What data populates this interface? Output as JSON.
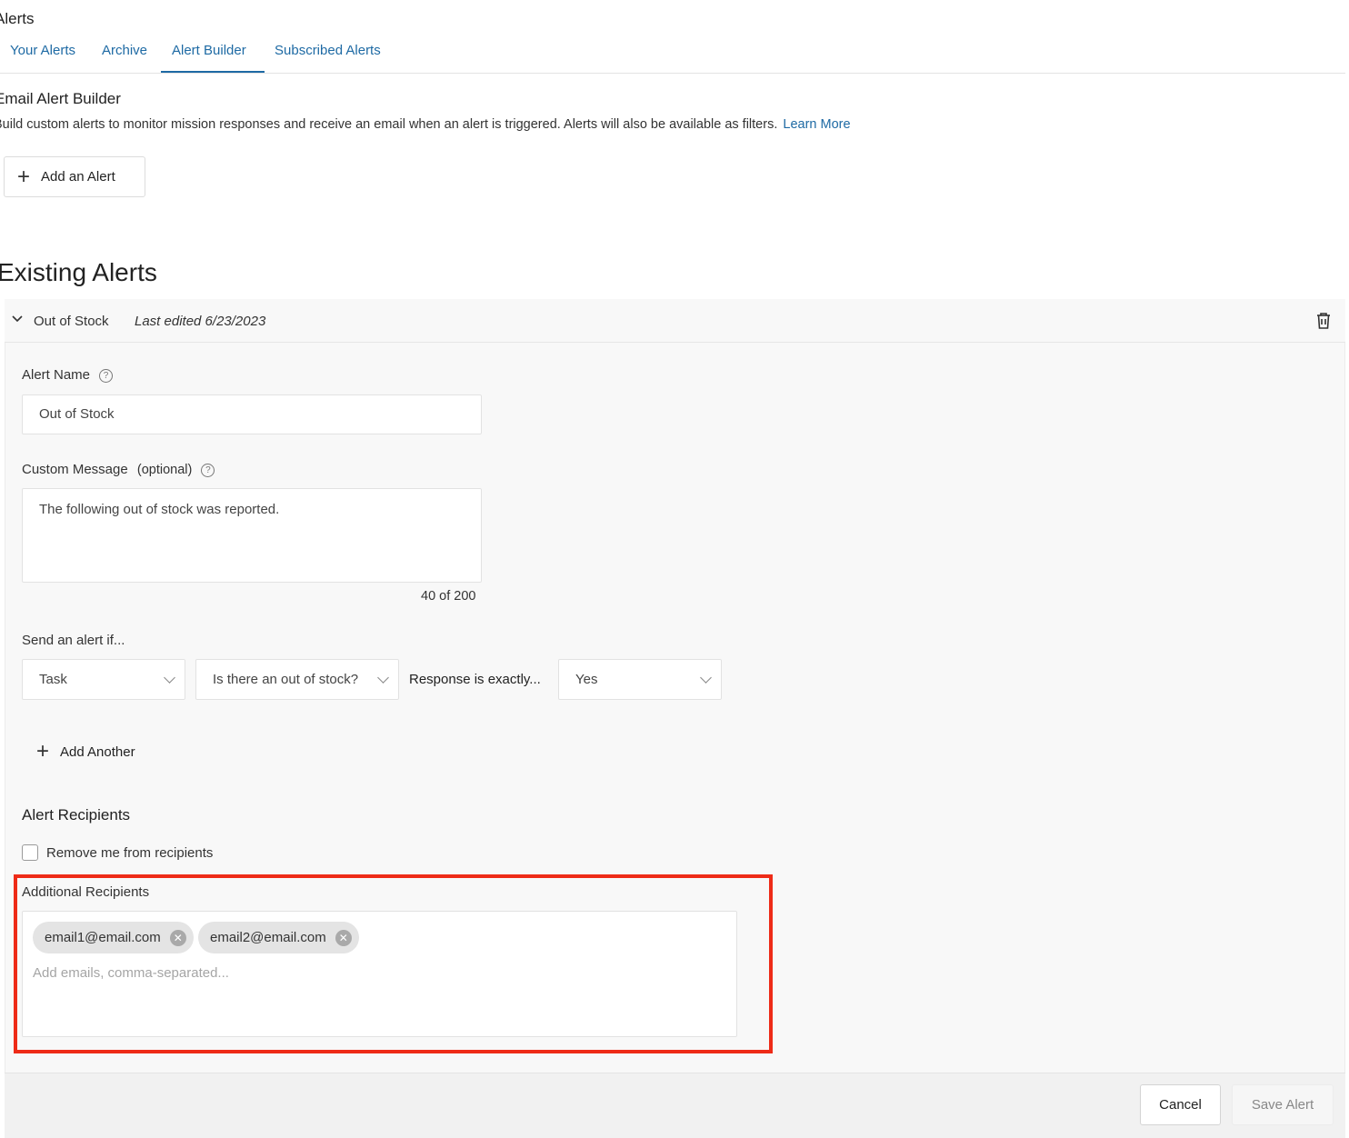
{
  "page": {
    "heading": "Alerts"
  },
  "tabs": [
    {
      "label": "Your Alerts"
    },
    {
      "label": "Archive"
    },
    {
      "label": "Alert Builder"
    },
    {
      "label": "Subscribed Alerts"
    }
  ],
  "builder": {
    "title": "Email Alert Builder",
    "description": "Build custom alerts to monitor mission responses and receive an email when an alert is triggered. Alerts will also be available as filters.",
    "learn_more": "Learn More",
    "add_alert_label": "Add an Alert"
  },
  "existing": {
    "title": "Existing Alerts",
    "alert": {
      "name": "Out of Stock",
      "last_edited": "Last edited 6/23/2023"
    }
  },
  "form": {
    "alert_name_label": "Alert Name",
    "alert_name_value": "Out of Stock",
    "custom_message_label": "Custom Message",
    "custom_message_optional": "(optional)",
    "custom_message_value": "The following out of stock was reported.",
    "char_count": "40 of 200",
    "condition_label": "Send an alert if...",
    "condition": {
      "type_select": "Task",
      "question_select": "Is there an out of stock?",
      "operator_text": "Response is exactly...",
      "value_select": "Yes"
    },
    "add_another_label": "Add Another",
    "recipients_heading": "Alert Recipients",
    "remove_me_label": "Remove me from recipients",
    "remove_me_checked": false,
    "additional_label": "Additional Recipients",
    "recipients": [
      "email1@email.com",
      "email2@email.com"
    ],
    "recipients_placeholder": "Add emails, comma-separated..."
  },
  "footer": {
    "cancel_label": "Cancel",
    "save_label": "Save Alert"
  },
  "colors": {
    "link": "#1e6aa4",
    "highlight": "#ee2b17",
    "panel_bg": "#f8f8f8"
  }
}
